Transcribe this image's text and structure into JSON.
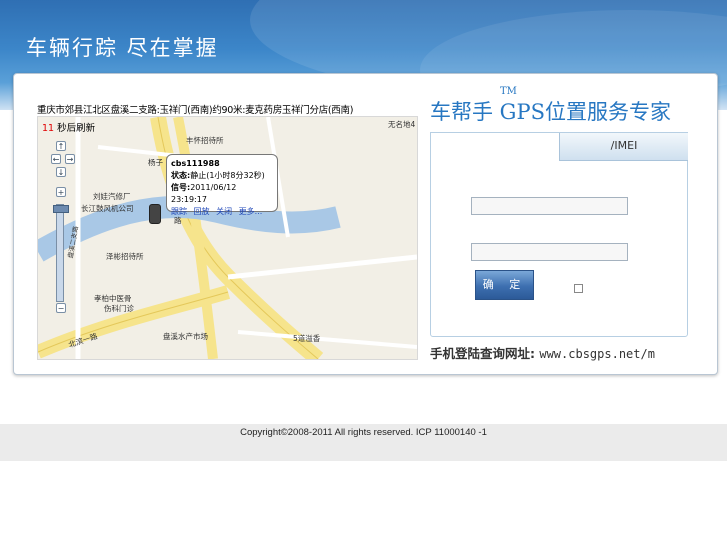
{
  "header": {
    "slogan": "车辆行踪  尽在掌握"
  },
  "map_panel": {
    "address": "重庆市郊县江北区盘溪二支路:玉祥门(西南)约90米:麦克药房玉祥门分店(西南)",
    "refresh_seconds": "11",
    "refresh_suffix": " 秒后刷新",
    "labels": [
      "丰怀招待所",
      "无名地4",
      "杨子",
      "刘娃汽修厂",
      "长江鼓风机公司",
      "泽彬招待所",
      "孝柏中医骨",
      "伤科门诊",
      "北滨一路",
      "盘溪水产市场",
      "5道溢香",
      "路",
      "盘溪二支路"
    ],
    "popup": {
      "vehicle_id": "cbs111988",
      "status_label": "状态:",
      "status_value": "静止(1小时8分32秒)",
      "signal_label": "信号:",
      "signal_value": "2011/06/12 23:19:17",
      "links": [
        "跟踪",
        "回放",
        "关闭",
        "更多..."
      ]
    }
  },
  "login": {
    "brand_title": "车帮手 GPS位置服务专家",
    "tm": "TM",
    "tab_label": "/IMEI",
    "username_value": "",
    "password_value": "",
    "submit_label": "确 定",
    "mobile_label": "手机登陆查询网址:",
    "mobile_url": "www.cbsgps.net/m"
  },
  "footer": {
    "copyright": "Copyright©2008-2011 All rights reserved. ICP 11000140 -1"
  },
  "colors": {
    "brand_blue": "#2777c2",
    "refresh_red": "#e00000",
    "link_blue": "#1f47b8"
  }
}
